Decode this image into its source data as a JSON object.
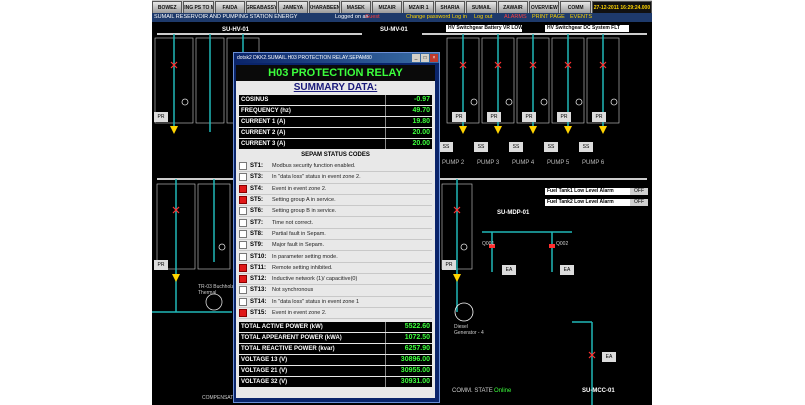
{
  "nav": {
    "buttons": [
      "BOWEZ",
      "EXISTING PS TO MALTA",
      "FAIDA",
      "GREABASSY",
      "JAMEYA",
      "KHARABEEN",
      "MASEK",
      "MIZAIR",
      "MZAIR 1",
      "SHARIA",
      "SUMAIL",
      "ZAWAIR",
      "OVERVIEW",
      "COMM"
    ],
    "timestamp": "27-12-2011 16:29:24.000"
  },
  "statusbar": {
    "title": "SUMAIL RESERVOIR AND PUMPING STATION ENERGY",
    "logged_on": "Logged on as",
    "user": "Guest",
    "change_password": "Change password",
    "log_in": "Log in",
    "log_out": "Log out",
    "alarms": "ALARMS",
    "print_page": "PRINT PAGE",
    "events": "EVENTS"
  },
  "scada": {
    "bus_hv01": "SU-HV-01",
    "bus_mv01": "SU-MV-01",
    "bus_mdp01": "SU-MDP-01",
    "bus_mcc01": "SU-MCC-01",
    "ind1": "HV Switchgear Battery VR LOW",
    "ind2": "HV Switchgear DC System FLT",
    "ind3": "Fuel Tank1 Low Level Alarm",
    "ind4": "Fuel Tank2 Low Level Alarm",
    "off": "OFF",
    "pumps": [
      "PUMP 2",
      "PUMP 3",
      "PUMP 4",
      "PUMP 5",
      "PUMP 6"
    ],
    "comm_state_label": "COMM. STATE",
    "comm_state_value": "Online",
    "compensation": "COMPENSATION",
    "diesel": "Diesel Generator - 4",
    "q001": "Q001",
    "q002": "Q002",
    "ea": "EA",
    "pr": "PR",
    "ss": "SS",
    "tr": "TR-03 Buchholz Thermal"
  },
  "relay": {
    "window_title": "dotsk2 DKK2.SUMAIL.H03 PROTECTION RELAY.SEPAM80",
    "title": "H03 PROTECTION RELAY",
    "summary_title": "SUMMARY DATA:",
    "summary": [
      {
        "label": "COSINUS",
        "value": "-0.97"
      },
      {
        "label": "FREQUENCY (hz)",
        "value": "49.70"
      },
      {
        "label": "CURRENT 1 (A)",
        "value": "19.80"
      },
      {
        "label": "CURRENT 2 (A)",
        "value": "20.00"
      },
      {
        "label": "CURRENT 3 (A)",
        "value": "20.00"
      }
    ],
    "sepam_title": "SEPAM STATUS CODES",
    "codes": [
      {
        "code": "ST1:",
        "text": "Modbus security function enabled.",
        "active": false
      },
      {
        "code": "ST3:",
        "text": "In \"data loss\" status in event zone 2.",
        "active": false
      },
      {
        "code": "ST4:",
        "text": "Event in event zone 2.",
        "active": true
      },
      {
        "code": "ST5:",
        "text": "Setting group A in service.",
        "active": true
      },
      {
        "code": "ST6:",
        "text": "Setting group B in service.",
        "active": false
      },
      {
        "code": "ST7:",
        "text": "Time not correct.",
        "active": false
      },
      {
        "code": "ST8:",
        "text": "Partial fault in Sepam.",
        "active": false
      },
      {
        "code": "ST9:",
        "text": "Major fault in Sepam.",
        "active": false
      },
      {
        "code": "ST10:",
        "text": "In parameter setting mode.",
        "active": false
      },
      {
        "code": "ST11:",
        "text": "Remote setting inhibited.",
        "active": true
      },
      {
        "code": "ST12:",
        "text": "Inductive network (1)/ capacitive(0)",
        "active": true
      },
      {
        "code": "ST13:",
        "text": "Not synchronous",
        "active": false
      },
      {
        "code": "ST14:",
        "text": "In \"data loss\" status in event zone 1",
        "active": false
      },
      {
        "code": "ST15:",
        "text": "Event in event zone 2.",
        "active": true
      }
    ],
    "power": [
      {
        "label": "TOTAL ACTIVE POWER (kW)",
        "value": "5522.60"
      },
      {
        "label": "TOTAL APPEARENT POWER (kWA)",
        "value": "1072.50"
      },
      {
        "label": "TOTAL REACTIVE POWER (kvar)",
        "value": "6257.90"
      },
      {
        "label": "VOLTAGE 13 (V)",
        "value": "30896.00"
      },
      {
        "label": "VOLTAGE 21 (V)",
        "value": "30955.00"
      },
      {
        "label": "VOLTAGE 32 (V)",
        "value": "30931.00"
      }
    ]
  }
}
